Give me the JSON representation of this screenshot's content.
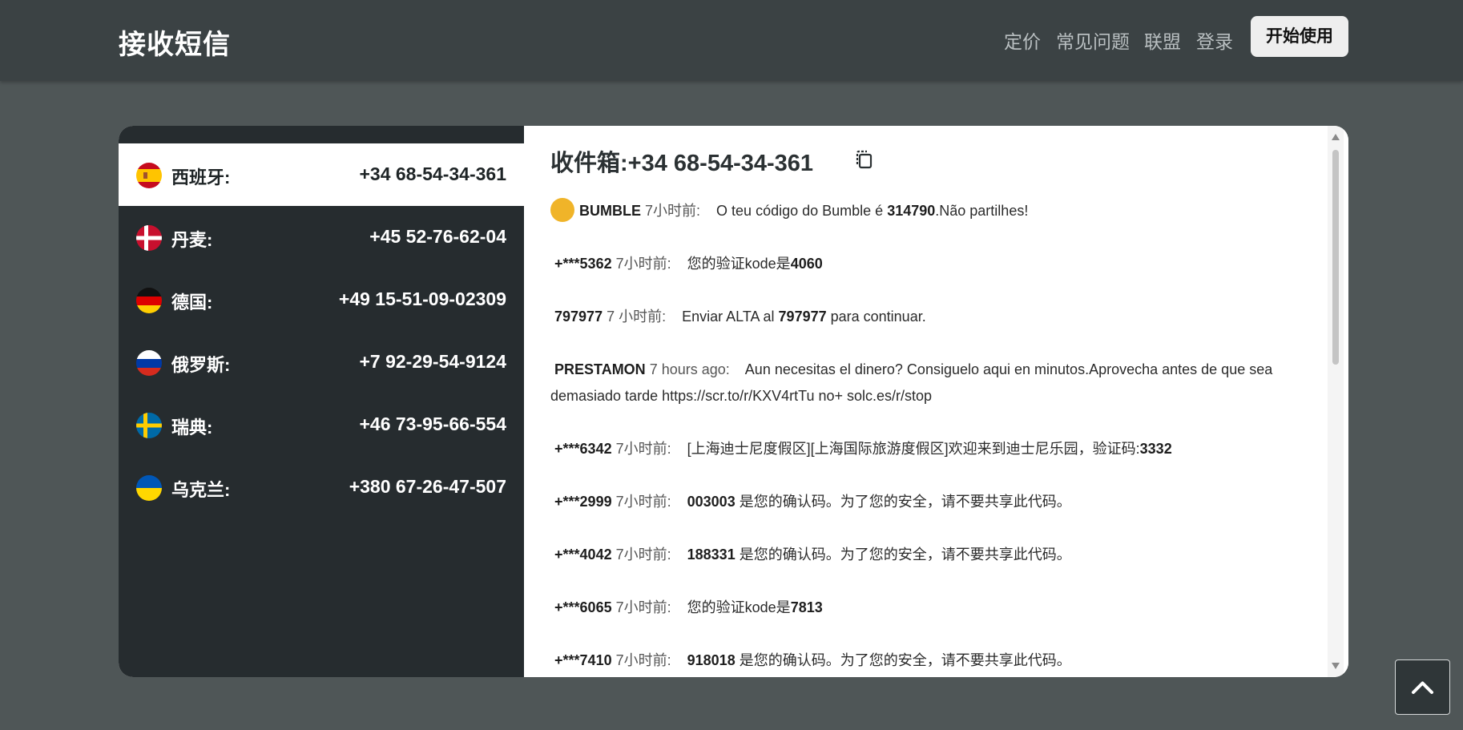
{
  "header": {
    "brand": "接收短信",
    "nav": [
      {
        "label": "定价"
      },
      {
        "label": "常见问题"
      },
      {
        "label": "联盟"
      },
      {
        "label": "登录"
      }
    ],
    "start_button": "开始使用"
  },
  "countries": [
    {
      "name": "西班牙:",
      "number": "+34 68-54-34-361",
      "flag": "spain-flag",
      "active": true
    },
    {
      "name": "丹麦:",
      "number": "+45 52-76-62-04",
      "flag": "denmark-flag",
      "active": false
    },
    {
      "name": "德国:",
      "number": "+49 15-51-09-02309",
      "flag": "germany-flag",
      "active": false
    },
    {
      "name": "俄罗斯:",
      "number": "+7 92-29-54-9124",
      "flag": "russia-flag",
      "active": false
    },
    {
      "name": "瑞典:",
      "number": "+46 73-95-66-554",
      "flag": "sweden-flag",
      "active": false
    },
    {
      "name": "乌克兰:",
      "number": "+380 67-26-47-507",
      "flag": "ukraine-flag",
      "active": false
    }
  ],
  "inbox": {
    "title": "收件箱:+34 68-54-34-361",
    "messages": [
      {
        "sender": "BUMBLE",
        "time": "7小时前:",
        "pre": "O teu código do Bumble é ",
        "code": "314790",
        "post": ".Não partilhes!"
      },
      {
        "sender": "+***5362",
        "time": "7小时前:",
        "pre": "您的验证kode是",
        "code": "4060",
        "post": ""
      },
      {
        "sender": "797977",
        "time": "7 小时前:",
        "pre": "Enviar ALTA al ",
        "code": "797977",
        "post": " para continuar."
      },
      {
        "sender": "PRESTAMON",
        "time": "7 hours ago:",
        "pre": "Aun necesitas el dinero?  Consiguelo aqui en minutos.Aprovecha antes de que sea demasiado tarde https://scr.to/r/KXV4rtTu no+ solc.es/r/stop",
        "code": "",
        "post": ""
      },
      {
        "sender": "+***6342",
        "time": "7小时前:",
        "pre": "[上海迪士尼度假区][上海国际旅游度假区]欢迎来到迪士尼乐园，验证码:",
        "code": "3332",
        "post": ""
      },
      {
        "sender": "+***2999",
        "time": "7小时前:",
        "pre": "",
        "code": "003003",
        "post": " 是您的确认码。为了您的安全，请不要共享此代码。"
      },
      {
        "sender": "+***4042",
        "time": "7小时前:",
        "pre": "",
        "code": "188331",
        "post": " 是您的确认码。为了您的安全，请不要共享此代码。"
      },
      {
        "sender": "+***6065",
        "time": "7小时前:",
        "pre": "您的验证kode是",
        "code": "7813",
        "post": ""
      },
      {
        "sender": "+***7410",
        "time": "7小时前:",
        "pre": "",
        "code": "918018",
        "post": " 是您的确认码。为了您的安全，请不要共享此代码。"
      }
    ]
  },
  "colors": {
    "accent_bumble": "#f0b429",
    "sidebar_bg": "#262c2f"
  }
}
